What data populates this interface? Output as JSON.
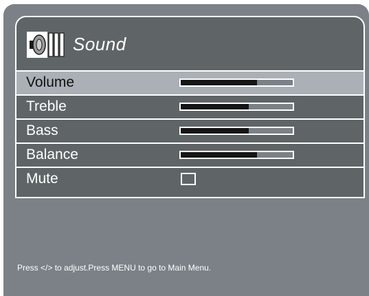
{
  "menu": {
    "title": "Sound",
    "icon": "speaker-icon",
    "selected_index": 0,
    "items": [
      {
        "label": "Volume",
        "type": "slider",
        "level": 0.68
      },
      {
        "label": "Treble",
        "type": "slider",
        "level": 0.61
      },
      {
        "label": "Bass",
        "type": "slider",
        "level": 0.61
      },
      {
        "label": "Balance",
        "type": "slider",
        "level": 0.68
      },
      {
        "label": "Mute",
        "type": "checkbox",
        "checked": false
      }
    ]
  },
  "footer": {
    "hint": "Press </> to adjust.Press MENU to go to Main Menu."
  },
  "colors": {
    "background": "#7b8187",
    "panel": "#5f6566",
    "selected_row": "#aab0b6",
    "bar_fill": "#151515",
    "border": "#ffffff"
  }
}
